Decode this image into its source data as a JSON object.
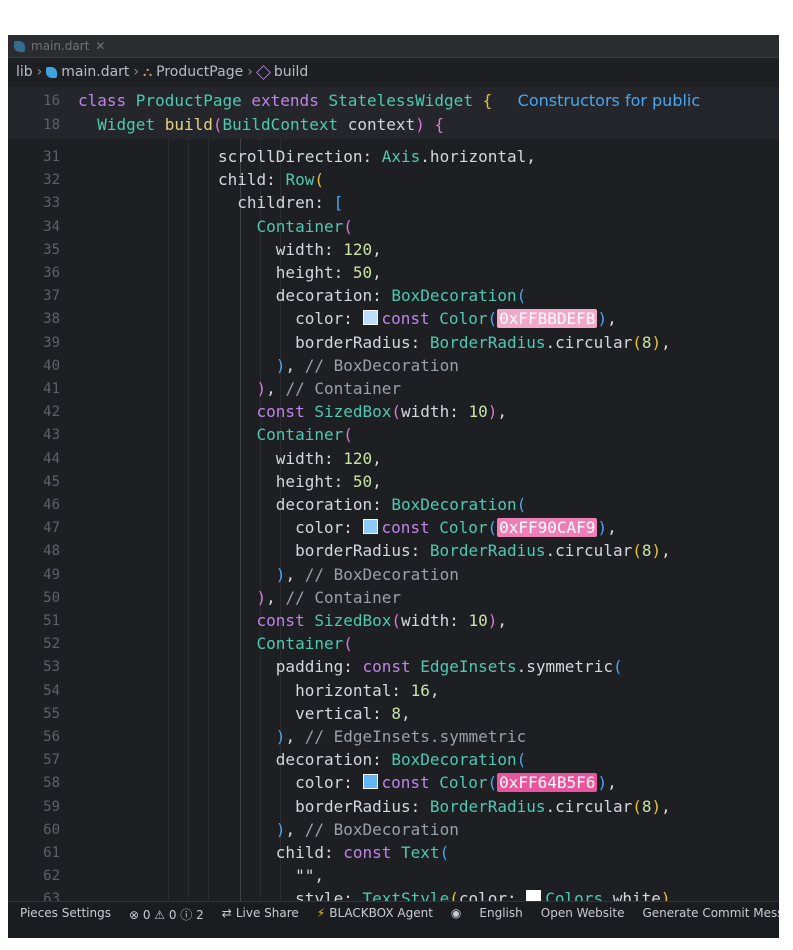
{
  "window": {
    "tab_label": "main.dart"
  },
  "breadcrumb": {
    "items": [
      "lib",
      "main.dart",
      "ProductPage",
      "build"
    ]
  },
  "sticky_scroll": [
    {
      "num": "16",
      "tokens": [
        [
          "kw",
          "class "
        ],
        [
          "ty",
          "ProductPage "
        ],
        [
          "kw",
          "extends "
        ],
        [
          "ty",
          "StatelessWidget "
        ],
        [
          "br",
          "{"
        ]
      ],
      "hint": "Constructors for public"
    },
    {
      "num": "18",
      "tokens": [
        [
          "ty",
          "  Widget "
        ],
        [
          "fn",
          "build"
        ],
        [
          "br2",
          "("
        ],
        [
          "ty",
          "BuildContext "
        ],
        [
          "",
          "context"
        ],
        [
          "br2",
          ") "
        ],
        [
          "br2",
          "{"
        ]
      ]
    }
  ],
  "code_lines": [
    {
      "num": "31",
      "tokens": [
        [
          "",
          "scrollDirection: "
        ],
        [
          "ty",
          "Axis"
        ],
        [
          "",
          ".horizontal,"
        ]
      ]
    },
    {
      "num": "32",
      "tokens": [
        [
          "",
          "child: "
        ],
        [
          "ty",
          "Row"
        ],
        [
          "br",
          "("
        ]
      ]
    },
    {
      "num": "33",
      "tokens": [
        [
          "",
          "  children: "
        ],
        [
          "br3",
          "["
        ]
      ]
    },
    {
      "num": "34",
      "tokens": [
        [
          "",
          "    "
        ],
        [
          "ty",
          "Container"
        ],
        [
          "br2",
          "("
        ]
      ]
    },
    {
      "num": "35",
      "tokens": [
        [
          "",
          "      width: "
        ],
        [
          "num",
          "120"
        ],
        [
          "",
          ","
        ]
      ]
    },
    {
      "num": "36",
      "tokens": [
        [
          "",
          "      height: "
        ],
        [
          "num",
          "50"
        ],
        [
          "",
          ","
        ]
      ]
    },
    {
      "num": "37",
      "tokens": [
        [
          "",
          "      decoration: "
        ],
        [
          "ty",
          "BoxDecoration"
        ],
        [
          "br3",
          "("
        ]
      ]
    },
    {
      "num": "38",
      "color_line": true,
      "indent": "        ",
      "swatch_color": "#FFBBDEFB",
      "hex": "0xFFBBDEFB",
      "hex_bg": "#f2a8c8"
    },
    {
      "num": "39",
      "tokens": [
        [
          "",
          "        borderRadius: "
        ],
        [
          "ty",
          "BorderRadius"
        ],
        [
          "",
          ".circular"
        ],
        [
          "br",
          "("
        ],
        [
          "num",
          "8"
        ],
        [
          "br",
          ")"
        ],
        [
          "",
          ","
        ]
      ]
    },
    {
      "num": "40",
      "tokens": [
        [
          "",
          "      "
        ],
        [
          "br3",
          ")"
        ],
        [
          "",
          ", "
        ],
        [
          "cm",
          "// BoxDecoration"
        ]
      ]
    },
    {
      "num": "41",
      "tokens": [
        [
          "",
          "    "
        ],
        [
          "br2",
          ")"
        ],
        [
          "",
          ", "
        ],
        [
          "cm",
          "// Container"
        ]
      ]
    },
    {
      "num": "42",
      "tokens": [
        [
          "",
          "    "
        ],
        [
          "kw",
          "const "
        ],
        [
          "ty",
          "SizedBox"
        ],
        [
          "br2",
          "("
        ],
        [
          "",
          "width: "
        ],
        [
          "num",
          "10"
        ],
        [
          "br2",
          ")"
        ],
        [
          "",
          ","
        ]
      ]
    },
    {
      "num": "43",
      "tokens": [
        [
          "",
          "    "
        ],
        [
          "ty",
          "Container"
        ],
        [
          "br2",
          "("
        ]
      ]
    },
    {
      "num": "44",
      "tokens": [
        [
          "",
          "      width: "
        ],
        [
          "num",
          "120"
        ],
        [
          "",
          ","
        ]
      ]
    },
    {
      "num": "45",
      "tokens": [
        [
          "",
          "      height: "
        ],
        [
          "num",
          "50"
        ],
        [
          "",
          ","
        ]
      ]
    },
    {
      "num": "46",
      "tokens": [
        [
          "",
          "      decoration: "
        ],
        [
          "ty",
          "BoxDecoration"
        ],
        [
          "br3",
          "("
        ]
      ]
    },
    {
      "num": "47",
      "color_line": true,
      "indent": "        ",
      "swatch_color": "#FF90CAF9",
      "hex": "0xFF90CAF9",
      "hex_bg": "#ee7fb6"
    },
    {
      "num": "48",
      "tokens": [
        [
          "",
          "        borderRadius: "
        ],
        [
          "ty",
          "BorderRadius"
        ],
        [
          "",
          ".circular"
        ],
        [
          "br",
          "("
        ],
        [
          "num",
          "8"
        ],
        [
          "br",
          ")"
        ],
        [
          "",
          ","
        ]
      ]
    },
    {
      "num": "49",
      "tokens": [
        [
          "",
          "      "
        ],
        [
          "br3",
          ")"
        ],
        [
          "",
          ", "
        ],
        [
          "cm",
          "// BoxDecoration"
        ]
      ]
    },
    {
      "num": "50",
      "tokens": [
        [
          "",
          "    "
        ],
        [
          "br2",
          ")"
        ],
        [
          "",
          ", "
        ],
        [
          "cm",
          "// Container"
        ]
      ]
    },
    {
      "num": "51",
      "tokens": [
        [
          "",
          "    "
        ],
        [
          "kw",
          "const "
        ],
        [
          "ty",
          "SizedBox"
        ],
        [
          "br2",
          "("
        ],
        [
          "",
          "width: "
        ],
        [
          "num",
          "10"
        ],
        [
          "br2",
          ")"
        ],
        [
          "",
          ","
        ]
      ]
    },
    {
      "num": "52",
      "tokens": [
        [
          "",
          "    "
        ],
        [
          "ty",
          "Container"
        ],
        [
          "br2",
          "("
        ]
      ]
    },
    {
      "num": "53",
      "tokens": [
        [
          "",
          "      padding: "
        ],
        [
          "kw",
          "const "
        ],
        [
          "ty",
          "EdgeInsets"
        ],
        [
          "",
          ".symmetric"
        ],
        [
          "br3",
          "("
        ]
      ]
    },
    {
      "num": "54",
      "tokens": [
        [
          "",
          "        horizontal: "
        ],
        [
          "num",
          "16"
        ],
        [
          "",
          ","
        ]
      ]
    },
    {
      "num": "55",
      "tokens": [
        [
          "",
          "        vertical: "
        ],
        [
          "num",
          "8"
        ],
        [
          "",
          ","
        ]
      ]
    },
    {
      "num": "56",
      "tokens": [
        [
          "",
          "      "
        ],
        [
          "br3",
          ")"
        ],
        [
          "",
          ", "
        ],
        [
          "cm",
          "// EdgeInsets.symmetric"
        ]
      ]
    },
    {
      "num": "57",
      "tokens": [
        [
          "",
          "      decoration: "
        ],
        [
          "ty",
          "BoxDecoration"
        ],
        [
          "br3",
          "("
        ]
      ]
    },
    {
      "num": "58",
      "color_line": true,
      "indent": "        ",
      "swatch_color": "#FF64B5F6",
      "hex": "0xFF64B5F6",
      "hex_bg": "#e8559d"
    },
    {
      "num": "59",
      "tokens": [
        [
          "",
          "        borderRadius: "
        ],
        [
          "ty",
          "BorderRadius"
        ],
        [
          "",
          ".circular"
        ],
        [
          "br",
          "("
        ],
        [
          "num",
          "8"
        ],
        [
          "br",
          ")"
        ],
        [
          "",
          ","
        ]
      ]
    },
    {
      "num": "60",
      "tokens": [
        [
          "",
          "      "
        ],
        [
          "br3",
          ")"
        ],
        [
          "",
          ", "
        ],
        [
          "cm",
          "// BoxDecoration"
        ]
      ]
    },
    {
      "num": "61",
      "tokens": [
        [
          "",
          "      child: "
        ],
        [
          "kw",
          "const "
        ],
        [
          "ty",
          "Text"
        ],
        [
          "br3",
          "("
        ]
      ]
    },
    {
      "num": "62",
      "tokens": [
        [
          "",
          "        \"\","
        ]
      ]
    },
    {
      "num": "63",
      "tokens": [
        [
          "",
          "        style: "
        ],
        [
          "ty",
          "TextStyle"
        ],
        [
          "br",
          "("
        ],
        [
          "",
          "color: "
        ],
        [
          "swatch",
          "#ffffff"
        ],
        [
          "ty",
          "Colors"
        ],
        [
          "",
          ".white"
        ],
        [
          "br",
          ")"
        ],
        [
          "",
          ","
        ]
      ]
    }
  ],
  "status": {
    "pieces": "Pieces Settings",
    "problems": "⊗ 0 ⚠ 0 ⓘ 2",
    "live_share": "Live Share",
    "blackbox": "BLACKBOX Agent",
    "language": "English",
    "open_website": "Open Website",
    "generate": "Generate Commit Message"
  },
  "colors": {
    "editor_bg": "#1e1f23",
    "keyword": "#c183e8",
    "type": "#4ec9b0"
  }
}
